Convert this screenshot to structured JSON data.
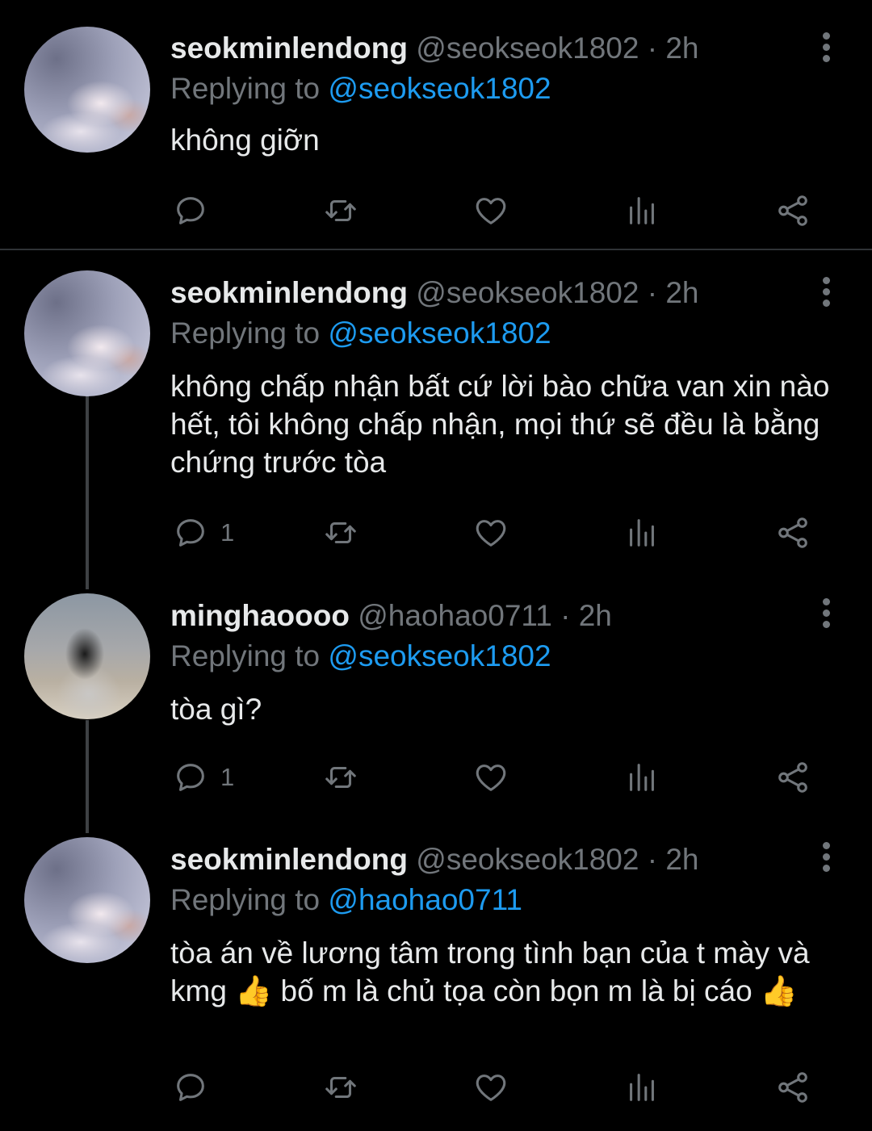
{
  "tweets": [
    {
      "name": "seokminlendong",
      "handle": "@seokseok1802",
      "dot": "·",
      "time": "2h",
      "replying_prefix": "Replying to ",
      "replying_to": "@seokseok1802",
      "text": "không giỡn",
      "reply_count": "",
      "avatar_icon": "avatar-cloud"
    },
    {
      "name": "seokminlendong",
      "handle": "@seokseok1802",
      "dot": "·",
      "time": "2h",
      "replying_prefix": "Replying to ",
      "replying_to": "@seokseok1802",
      "text": "không chấp nhận bất cứ lời bào chữa van xin nào hết, tôi không chấp nhận, mọi thứ sẽ đều là bằng chứng trước tòa",
      "reply_count": "1",
      "avatar_icon": "avatar-cloud"
    },
    {
      "name": "minghaoooo",
      "handle": "@haohao0711",
      "dot": "·",
      "time": "2h",
      "replying_prefix": "Replying to ",
      "replying_to": "@seokseok1802",
      "text": "tòa gì?",
      "reply_count": "1",
      "avatar_icon": "avatar-person"
    },
    {
      "name": "seokminlendong",
      "handle": "@seokseok1802",
      "dot": "·",
      "time": "2h",
      "replying_prefix": "Replying to ",
      "replying_to": "@haohao0711",
      "text": "tòa án về lương tâm trong tình bạn của t mày và kmg 👍 bố m là chủ tọa còn bọn m là bị cáo 👍",
      "reply_count": "",
      "avatar_icon": "avatar-cloud"
    }
  ],
  "icons": {
    "reply": "reply-icon",
    "retweet": "retweet-icon",
    "like": "heart-icon",
    "views": "analytics-icon",
    "share": "share-icon",
    "more": "more-vertical-icon"
  },
  "colors": {
    "background": "#000000",
    "text": "#e7e9ea",
    "muted": "#71767b",
    "mention": "#1d9bf0",
    "divider": "#2f3336"
  }
}
